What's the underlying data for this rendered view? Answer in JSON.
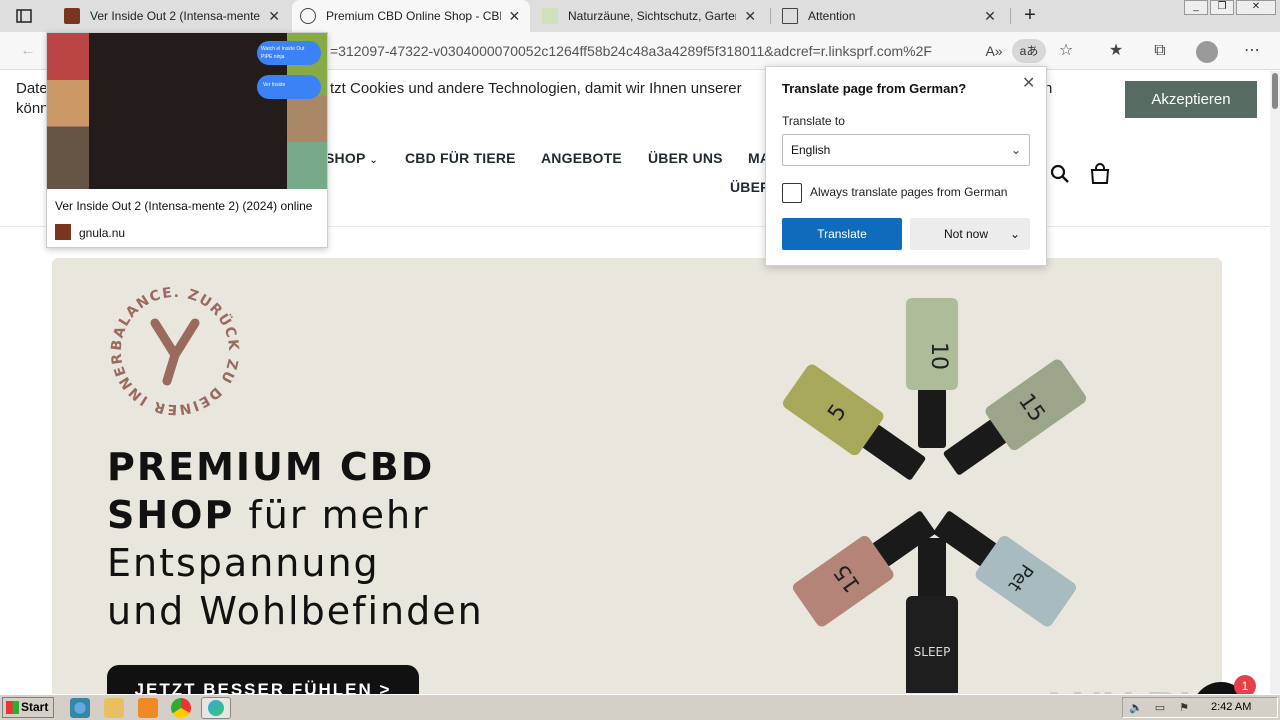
{
  "tabs": [
    {
      "title": "Ver Inside Out 2 (Intensa-mente 2) (2024) online",
      "favicon_color": "#7a3420"
    },
    {
      "title": "Premium CBD Online Shop - CBD",
      "favicon_color": "#555555"
    },
    {
      "title": "Naturzäune, Sichtschutz, Garten",
      "favicon_color": "#6a9a3a"
    },
    {
      "title": "Attention",
      "favicon_color": "#ffffff"
    }
  ],
  "toolbar": {
    "address": "=312097-47322-v0304000070052c1264ff58b24c48a3a4289f5f318011&adcref=r.linksprf.com%2F",
    "translate_icon": "aあ"
  },
  "cookie": {
    "text_left": "Date",
    "text_left2": "könn",
    "text_mid": "tzt Cookies und andere Technologien, damit wir Ihnen unserer",
    "text_right": "n",
    "accept": "Akzeptieren"
  },
  "nav": {
    "shop": "SHOP",
    "tiere": "CBD FÜR TIERE",
    "angebote": "ANGEBOTE",
    "ueber_uns": "ÜBER UNS",
    "ma": "MA",
    "ueber2": "ÜBER"
  },
  "hero": {
    "logo_text": "BALANCE. ZURÜCK ZU DEINER INNEREN",
    "line1_bold": "PREMIUM CBD",
    "line2_bold": "SHOP",
    "line2_rest": " für mehr",
    "line3": "Entspannung",
    "line4": "und Wohlbefinden",
    "cta": "JETZT BESSER FÜHLEN >",
    "bottle_labels": [
      "10",
      "15",
      "5",
      "15",
      "SLEEP",
      "Pet"
    ]
  },
  "preview": {
    "title": "Ver Inside Out 2 (Intensa-mente 2) (2024) online",
    "site": "gnula.nu",
    "bubble1": "Watch el Inside Out PIPE ninja",
    "bubble2": "Ver Inside"
  },
  "translate_popup": {
    "title": "Translate page from German?",
    "label": "Translate to",
    "selected": "English",
    "checkbox_label": "Always translate pages from German",
    "translate": "Translate",
    "not_now": "Not now"
  },
  "chat": {
    "badge": "1"
  },
  "watermark": "ANY RUN",
  "taskbar": {
    "start": "Start",
    "clock": "2:42 AM"
  },
  "colors": {
    "accept_bg": "#566b62",
    "hero_bg": "#e9e6dd",
    "translate_btn": "#0f6cbd",
    "logo_color": "#9b6a5e"
  }
}
